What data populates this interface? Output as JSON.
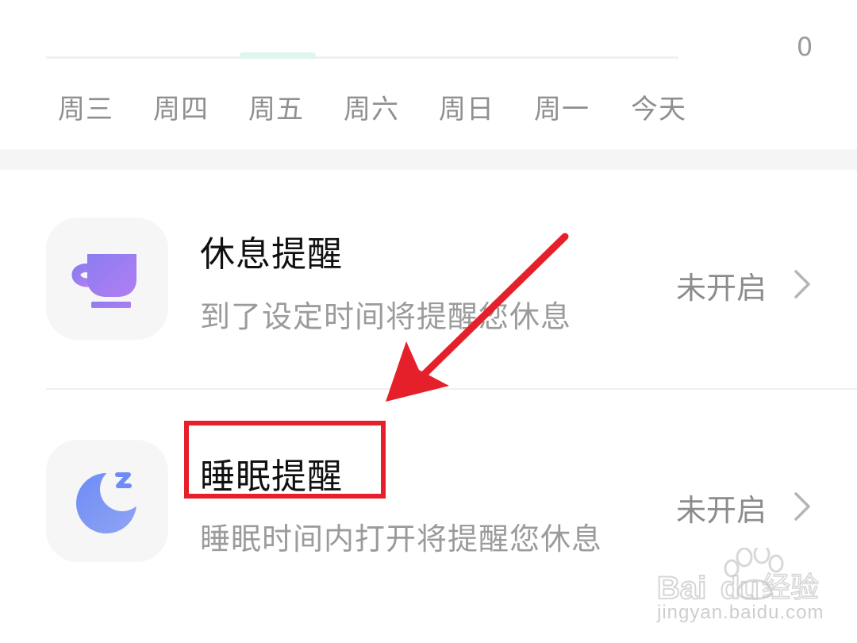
{
  "chart": {
    "axis_value": "0",
    "days": [
      "周三",
      "周四",
      "周五",
      "周六",
      "周日",
      "周一",
      "今天"
    ]
  },
  "reminders": [
    {
      "title": "休息提醒",
      "subtitle": "到了设定时间将提醒您休息",
      "status": "未开启",
      "icon": "coffee-cup-icon",
      "icon_color": "#9b7df2"
    },
    {
      "title": "睡眠提醒",
      "subtitle": "睡眠时间内打开将提醒您休息",
      "status": "未开启",
      "icon": "moon-sleep-icon",
      "icon_color": "#7d95f3"
    }
  ],
  "annotation": {
    "highlight_color": "#e6202a",
    "highlight_target": "睡眠提醒"
  },
  "watermark": {
    "brand": "Bai du 经验",
    "url": "jingyan.baidu.com"
  }
}
